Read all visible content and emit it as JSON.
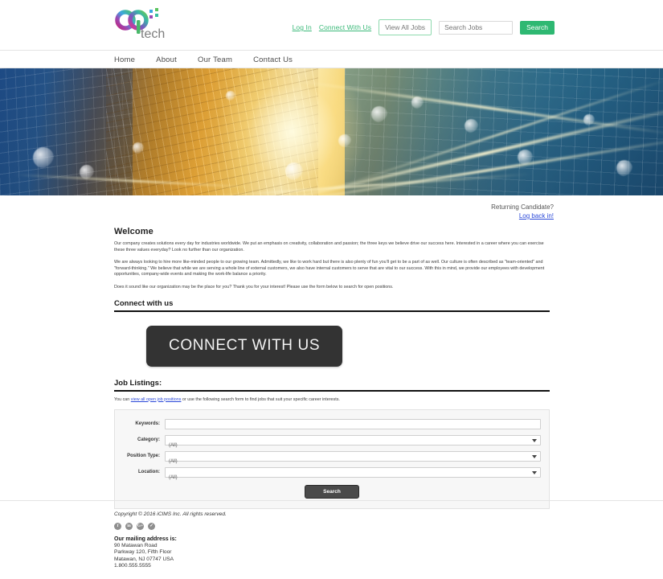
{
  "header": {
    "logo": {
      "main_text": "cp",
      "sub_text": "tech",
      "name": "cptech-logo"
    },
    "links": [
      {
        "label": "Log In",
        "name": "log-in-link"
      },
      {
        "label": "Connect With Us",
        "name": "connect-with-us-link"
      }
    ],
    "view_all_jobs_label": "View All Jobs",
    "search_jobs_placeholder": "Search Jobs",
    "search_jobs_value": "",
    "search_button_label": "Search",
    "accent_green": "#2eb872",
    "link_green": "#3cba7a"
  },
  "nav": {
    "items": [
      {
        "label": "Home",
        "name": "nav-item-home"
      },
      {
        "label": "About",
        "name": "nav-item-about"
      },
      {
        "label": "Our Team",
        "name": "nav-item-our-team"
      },
      {
        "label": "Contact Us",
        "name": "nav-item-contact-us"
      }
    ]
  },
  "hero": {
    "alt": "city skyline with golden light streaks banner"
  },
  "returning_candidate": {
    "label": "Returning Candidate?",
    "link_label": "Log back in!"
  },
  "welcome": {
    "title": "Welcome",
    "paragraphs": [
      "Our company creates solutions every day for industries worldwide. We put an emphasis on creativity, collaboration and passion; the three keys we believe drive our success here. Interested in a career where you can exercise these three values everyday? Look no further than our organization.",
      "We are always looking to hire more like-minded people to our growing team. Admittedly, we like to work hard but there is also plenty of fun you'll get to be a part of as well. Our culture is often described as \"team-oriented\" and \"forward-thinking.\" We believe that while we are serving a whole line of external customers, we also have internal customers to serve that are vital to our success. With this in mind, we provide our employees with development opportunities, company-wide events and making the work-life balance a priority.",
      "Does it sound like our organization may be the place for you? Thank you for your interest! Please use the form below to search for open positions."
    ]
  },
  "connect_section": {
    "title": "Connect with us",
    "button_label": "CONNECT WITH US"
  },
  "job_listings": {
    "title": "Job Listings:",
    "note_prefix": "You can ",
    "note_link": "view all open job positions",
    "note_suffix": " or use the following search form to find jobs that suit your specific career interests.",
    "form": {
      "keywords": {
        "label": "Keywords:",
        "value": "",
        "placeholder": ""
      },
      "category": {
        "label": "Category:",
        "value": "(All)"
      },
      "position_type": {
        "label": "Position Type:",
        "value": "(All)"
      },
      "location": {
        "label": "Location:",
        "value": "(All)"
      },
      "submit_label": "Search"
    }
  },
  "footer": {
    "copyright": "Copyright © 2016 iCIMS Inc. All rights reserved.",
    "social": [
      {
        "glyph": "f",
        "name": "facebook-icon"
      },
      {
        "glyph": "in",
        "name": "linkedin-icon"
      },
      {
        "glyph": "G+",
        "name": "google-plus-icon"
      },
      {
        "glyph": "✓",
        "name": "twitter-icon"
      }
    ],
    "address_title": "Our mailing address is:",
    "address_lines": [
      "90 Matawan Road",
      "Parkway 120, Fifth Floor",
      "Matawan, NJ 07747 USA",
      "1.800.555.5555"
    ]
  }
}
